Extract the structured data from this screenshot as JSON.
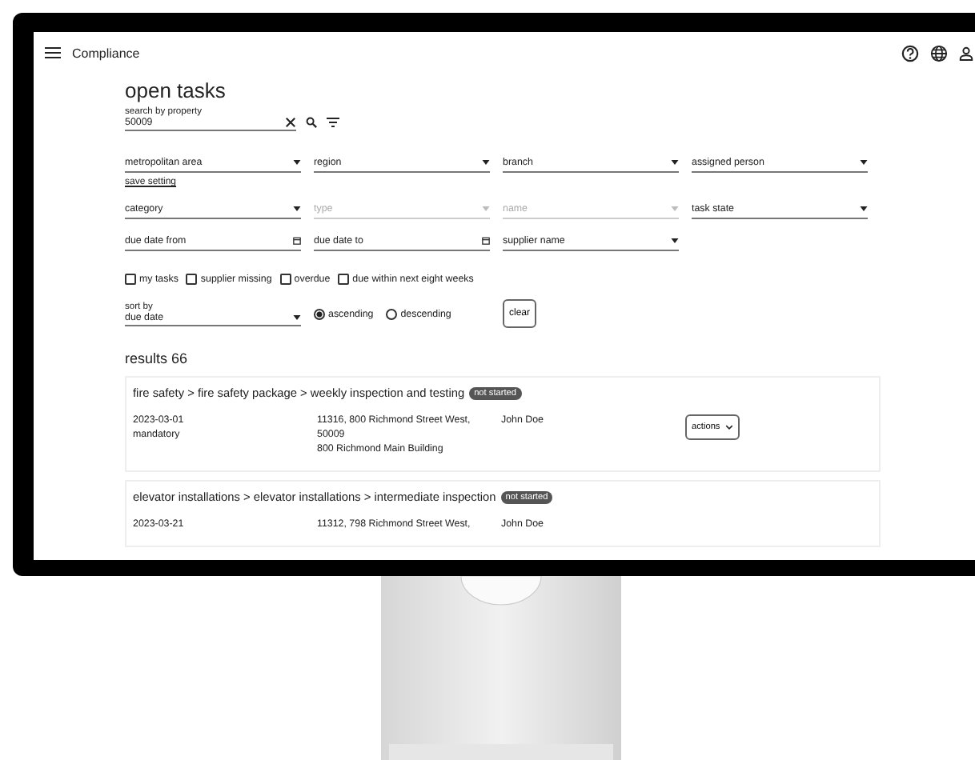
{
  "app_bar": {
    "title": "Compliance"
  },
  "heading": "open tasks",
  "search": {
    "label": "search by property",
    "value": "50009"
  },
  "filter_rows": [
    {
      "fields": [
        {
          "kind": "select",
          "label": "metropolitan area",
          "disabled": false
        },
        {
          "kind": "select",
          "label": "region",
          "disabled": false
        },
        {
          "kind": "select",
          "label": "branch",
          "disabled": false
        },
        {
          "kind": "select",
          "label": "assigned person",
          "disabled": false
        }
      ],
      "link": "save setting"
    },
    {
      "fields": [
        {
          "kind": "select",
          "label": "category",
          "disabled": false
        },
        {
          "kind": "select",
          "label": "type",
          "disabled": true
        },
        {
          "kind": "select",
          "label": "name",
          "disabled": true
        },
        {
          "kind": "select",
          "label": "task state",
          "disabled": false
        }
      ]
    },
    {
      "fields": [
        {
          "kind": "date",
          "label": "due date from",
          "disabled": false
        },
        {
          "kind": "date",
          "label": "due date to",
          "disabled": false
        },
        {
          "kind": "select",
          "label": "supplier name",
          "disabled": false
        }
      ]
    }
  ],
  "checkboxes": [
    {
      "label": "my tasks",
      "checked": false
    },
    {
      "label": "supplier missing",
      "checked": false
    },
    {
      "label": "overdue",
      "checked": false
    },
    {
      "label": "due within next eight weeks",
      "checked": false
    }
  ],
  "sort": {
    "label": "sort by",
    "value": "due date",
    "options": [
      {
        "label": "ascending",
        "selected": true
      },
      {
        "label": "descending",
        "selected": false
      }
    ]
  },
  "clear_button": "clear",
  "results_heading": "results 66",
  "tasks": [
    {
      "path": "fire safety > fire safety package > weekly inspection and testing",
      "status": "not started",
      "date": "2023-03-01",
      "requirement": "mandatory",
      "address": [
        "11316, 800 Richmond Street West,",
        "50009",
        "800 Richmond Main Building"
      ],
      "person": "John Doe",
      "action": "actions"
    },
    {
      "path": "elevator installations > elevator installations > intermediate inspection",
      "status": "not started",
      "date": "2023-03-21",
      "address": [
        "11312, 798 Richmond Street West,"
      ],
      "person": "John Doe"
    }
  ]
}
